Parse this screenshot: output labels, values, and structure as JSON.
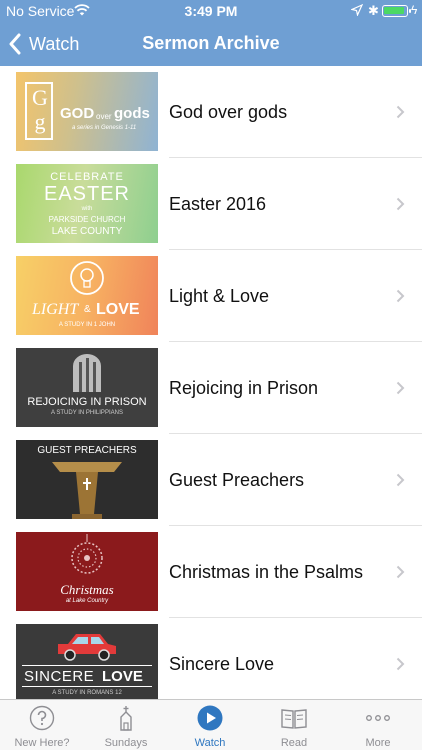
{
  "status_bar": {
    "carrier": "No Service",
    "time": "3:49 PM",
    "battery_color": "#4cd964"
  },
  "nav": {
    "back_label": "Watch",
    "title": "Sermon Archive"
  },
  "accent_color": "#6f9fd3",
  "series": [
    {
      "title": "God over gods",
      "art": {
        "monogram": "G g",
        "name_a": "GOD",
        "name_b": "over",
        "name_c": "gods",
        "caption": "a series in Genesis 1-11"
      }
    },
    {
      "title": "Easter 2016",
      "art": {
        "line1": "CELEBRATE",
        "line2": "EASTER",
        "line3": "with",
        "line4": "PARKSIDE CHURCH",
        "line5": "LAKE COUNTY"
      }
    },
    {
      "title": "Light & Love",
      "art": {
        "name_a": "LIGHT",
        "name_b": "&",
        "name_c": "LOVE",
        "caption": "A STUDY IN 1 JOHN"
      }
    },
    {
      "title": "Rejoicing in Prison",
      "art": {
        "name": "REJOICING IN PRISON",
        "caption": "A STUDY IN PHILIPPIANS"
      }
    },
    {
      "title": "Guest Preachers",
      "art": {
        "name": "GUEST PREACHERS"
      }
    },
    {
      "title": "Christmas in the Psalms",
      "art": {
        "name": "Christmas",
        "caption": "at Lake Country"
      }
    },
    {
      "title": "Sincere Love",
      "art": {
        "name_a": "SINCERE",
        "name_b": "LOVE",
        "caption": "A STUDY IN ROMANS 12"
      }
    }
  ],
  "tabs": [
    {
      "label": "New Here?",
      "icon": "question-icon"
    },
    {
      "label": "Sundays",
      "icon": "church-icon"
    },
    {
      "label": "Watch",
      "icon": "play-icon"
    },
    {
      "label": "Read",
      "icon": "book-icon"
    },
    {
      "label": "More",
      "icon": "more-icon"
    }
  ]
}
